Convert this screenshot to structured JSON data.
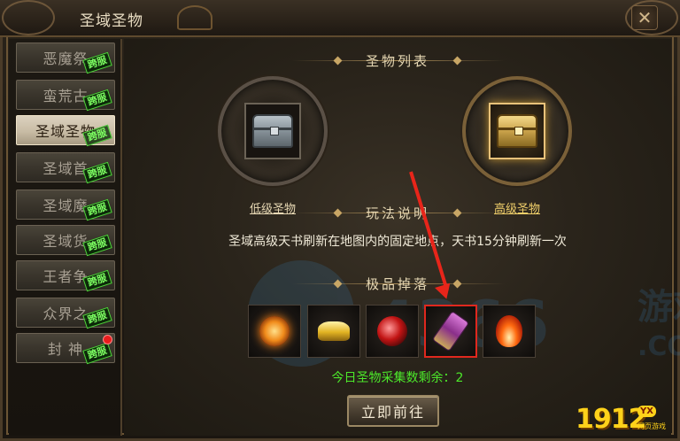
{
  "window": {
    "title": "圣域圣物",
    "close_label": "✕"
  },
  "sidebar": {
    "items": [
      {
        "label": "恶魔祭",
        "badge": "跨服",
        "active": false,
        "dot": false
      },
      {
        "label": "蛮荒古",
        "badge": "跨服",
        "active": false,
        "dot": false
      },
      {
        "label": "圣域圣物",
        "badge": "跨服",
        "active": true,
        "dot": false
      },
      {
        "label": "圣域首",
        "badge": "跨服",
        "active": false,
        "dot": false
      },
      {
        "label": "圣域魔",
        "badge": "跨服",
        "active": false,
        "dot": false
      },
      {
        "label": "圣域货",
        "badge": "跨服",
        "active": false,
        "dot": false
      },
      {
        "label": "王者争",
        "badge": "跨服",
        "active": false,
        "dot": false
      },
      {
        "label": "众界之",
        "badge": "跨服",
        "active": false,
        "dot": false
      },
      {
        "label": "封 神",
        "badge": "跨服",
        "active": false,
        "dot": true
      }
    ]
  },
  "main": {
    "list_title": "圣物列表",
    "low": {
      "label": "低级圣物",
      "icon": "silver-chest-icon"
    },
    "high": {
      "label": "高级圣物",
      "icon": "gold-chest-icon"
    },
    "rules_title": "玩法说明",
    "rules_text": "圣域高级天书刷新在地图内的固定地点，天书15分钟刷新一次",
    "drops_title": "极品掉落",
    "drops": [
      {
        "icon": "sun-emblem-icon"
      },
      {
        "icon": "gold-ingot-icon"
      },
      {
        "icon": "red-orb-icon"
      },
      {
        "icon": "purple-scroll-icon",
        "highlighted": true
      },
      {
        "icon": "flame-icon"
      }
    ],
    "remaining_text": "今日圣物采集数剩余：2",
    "go_button": "立即前往"
  },
  "colors": {
    "accent_gold": "#e8c27a",
    "green_text": "#4ce82a",
    "highlight_red": "#e8251a",
    "badge_green": "#7dff62"
  },
  "watermark": {
    "text": "4366",
    "cn": "游戏",
    "com": ".COM"
  },
  "logo": {
    "number": "1912",
    "tag": "YX",
    "sub": "网页游戏"
  }
}
